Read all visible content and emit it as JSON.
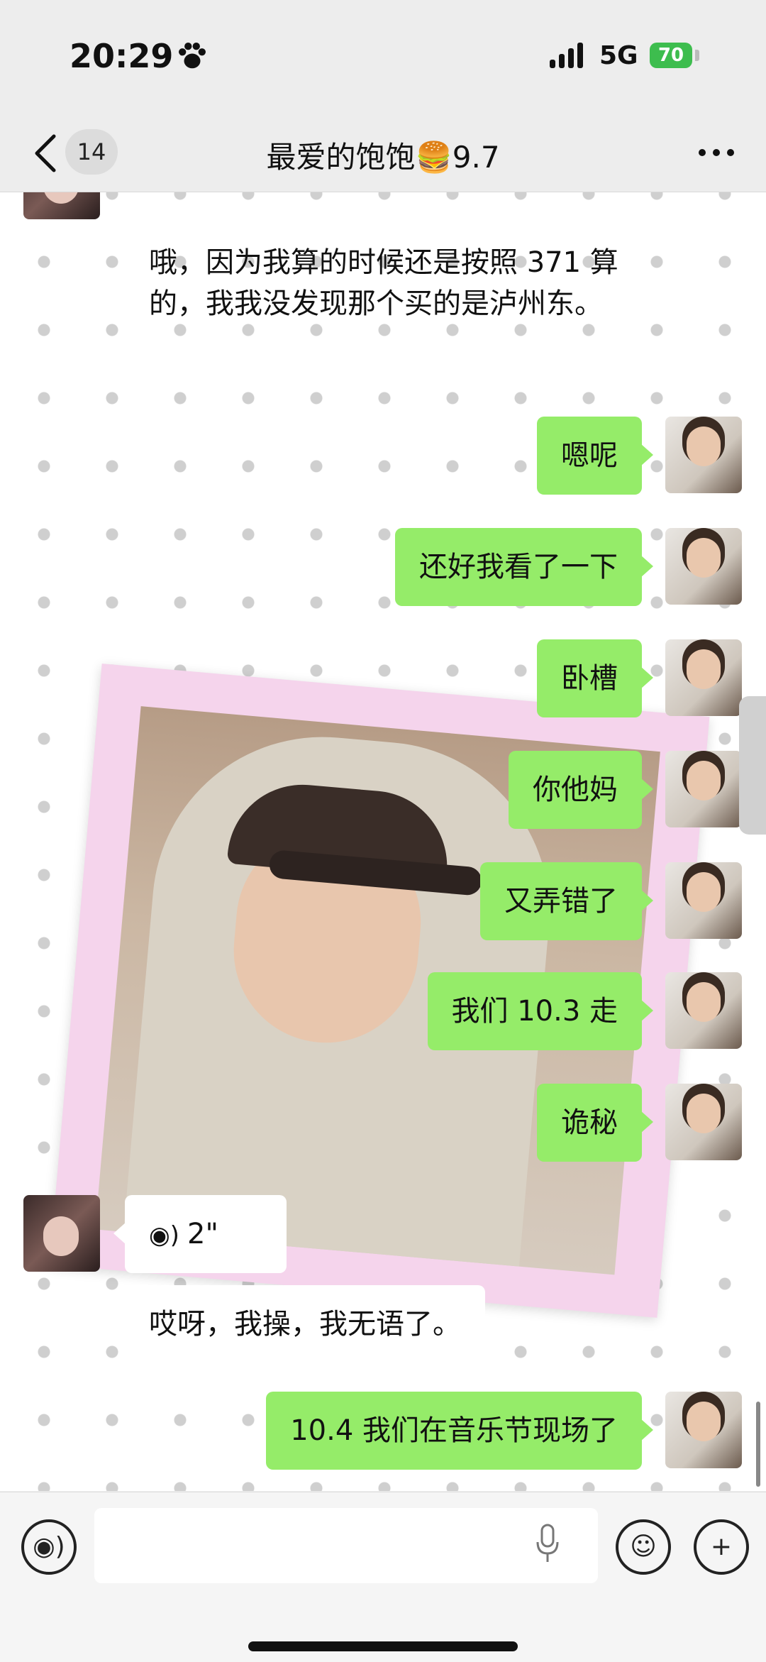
{
  "status": {
    "time": "20:29",
    "network": "5G",
    "battery": "70"
  },
  "nav": {
    "unread_count": "14",
    "title": "最爱的饱饱🍔9.7"
  },
  "messages": {
    "incoming_text_top": "哦，因为我算的时候还是按照 371 算的，我我没发现那个买的是泸州东。",
    "out_1": "嗯呢",
    "out_2": "还好我看了一下",
    "out_3": "卧槽",
    "out_4": "你他妈",
    "out_5": "又弄错了",
    "out_6": "我们 10.3 走",
    "out_7": "诡秘",
    "voice_duration": "2\"",
    "incoming_2": "哎呀，我操，我无语了。",
    "out_8": "10.4 我们在音乐节现场了"
  },
  "input": {
    "placeholder": ""
  },
  "colors": {
    "out_bubble": "#95ec69",
    "in_bubble": "#ffffff",
    "battery": "#3dbd4e"
  }
}
